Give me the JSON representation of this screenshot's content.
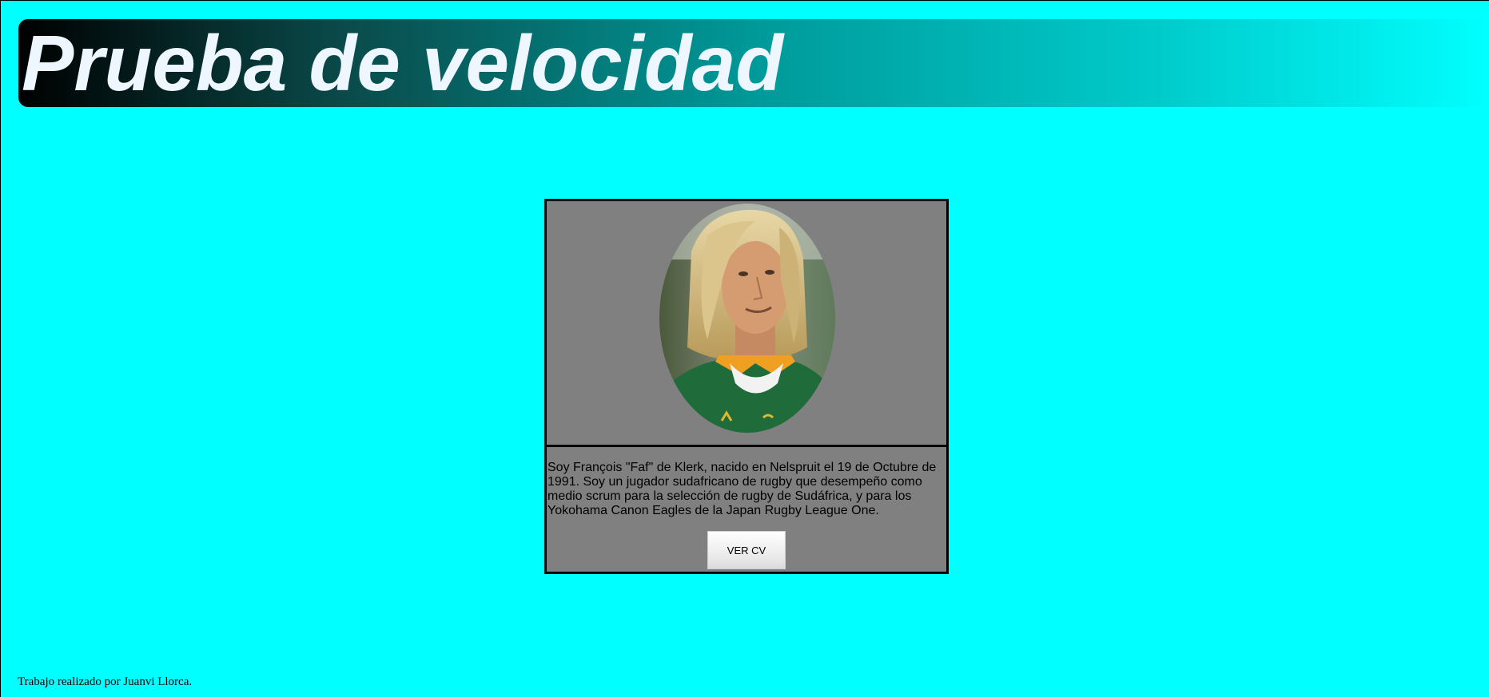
{
  "header": {
    "title": "Prueba de velocidad"
  },
  "profile": {
    "photo_alt": "Faf de Klerk",
    "bio": "Soy François \"Faf\" de Klerk, nacido en Nelspruit el 19 de Octubre de 1991. Soy un jugador sudafricano de rugby que desempeño como medio scrum para la selección de rugby de Sudáfrica, y para los Yokohama Canon Eagles de la Japan Rugby League One.",
    "cv_button_label": "VER CV"
  },
  "footer": {
    "credit": "Trabajo realizado por Juanvi Llorca."
  },
  "colors": {
    "page_background": "#00ffff",
    "card_background": "#808080",
    "card_border": "#000000",
    "title_text": "#eef6ff"
  }
}
